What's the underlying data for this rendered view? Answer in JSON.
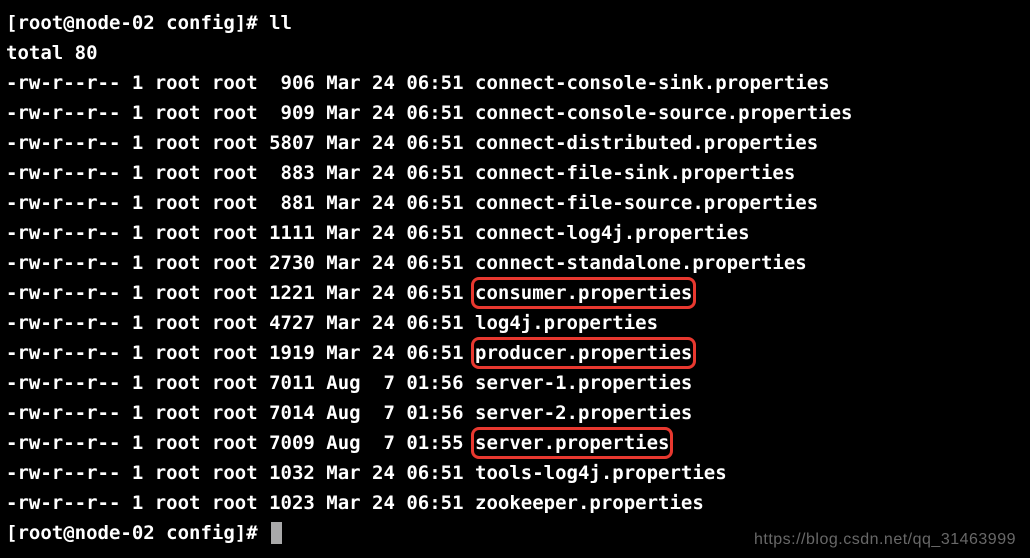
{
  "prompt1": "[root@node-02 config]# ",
  "command": "ll",
  "total_line": "total 80",
  "files": [
    {
      "perm": "-rw-r--r--",
      "links": "1",
      "owner": "root",
      "group": "root",
      "size": "  906",
      "date": "Mar 24 06:51",
      "name": "connect-console-sink.properties",
      "hl": false
    },
    {
      "perm": "-rw-r--r--",
      "links": "1",
      "owner": "root",
      "group": "root",
      "size": "  909",
      "date": "Mar 24 06:51",
      "name": "connect-console-source.properties",
      "hl": false
    },
    {
      "perm": "-rw-r--r--",
      "links": "1",
      "owner": "root",
      "group": "root",
      "size": " 5807",
      "date": "Mar 24 06:51",
      "name": "connect-distributed.properties",
      "hl": false
    },
    {
      "perm": "-rw-r--r--",
      "links": "1",
      "owner": "root",
      "group": "root",
      "size": "  883",
      "date": "Mar 24 06:51",
      "name": "connect-file-sink.properties",
      "hl": false
    },
    {
      "perm": "-rw-r--r--",
      "links": "1",
      "owner": "root",
      "group": "root",
      "size": "  881",
      "date": "Mar 24 06:51",
      "name": "connect-file-source.properties",
      "hl": false
    },
    {
      "perm": "-rw-r--r--",
      "links": "1",
      "owner": "root",
      "group": "root",
      "size": " 1111",
      "date": "Mar 24 06:51",
      "name": "connect-log4j.properties",
      "hl": false
    },
    {
      "perm": "-rw-r--r--",
      "links": "1",
      "owner": "root",
      "group": "root",
      "size": " 2730",
      "date": "Mar 24 06:51",
      "name": "connect-standalone.properties",
      "hl": false
    },
    {
      "perm": "-rw-r--r--",
      "links": "1",
      "owner": "root",
      "group": "root",
      "size": " 1221",
      "date": "Mar 24 06:51",
      "name": "consumer.properties",
      "hl": true
    },
    {
      "perm": "-rw-r--r--",
      "links": "1",
      "owner": "root",
      "group": "root",
      "size": " 4727",
      "date": "Mar 24 06:51",
      "name": "log4j.properties",
      "hl": false
    },
    {
      "perm": "-rw-r--r--",
      "links": "1",
      "owner": "root",
      "group": "root",
      "size": " 1919",
      "date": "Mar 24 06:51",
      "name": "producer.properties",
      "hl": true
    },
    {
      "perm": "-rw-r--r--",
      "links": "1",
      "owner": "root",
      "group": "root",
      "size": " 7011",
      "date": "Aug  7 01:56",
      "name": "server-1.properties",
      "hl": false
    },
    {
      "perm": "-rw-r--r--",
      "links": "1",
      "owner": "root",
      "group": "root",
      "size": " 7014",
      "date": "Aug  7 01:56",
      "name": "server-2.properties",
      "hl": false
    },
    {
      "perm": "-rw-r--r--",
      "links": "1",
      "owner": "root",
      "group": "root",
      "size": " 7009",
      "date": "Aug  7 01:55",
      "name": "server.properties",
      "hl": true
    },
    {
      "perm": "-rw-r--r--",
      "links": "1",
      "owner": "root",
      "group": "root",
      "size": " 1032",
      "date": "Mar 24 06:51",
      "name": "tools-log4j.properties",
      "hl": false
    },
    {
      "perm": "-rw-r--r--",
      "links": "1",
      "owner": "root",
      "group": "root",
      "size": " 1023",
      "date": "Mar 24 06:51",
      "name": "zookeeper.properties",
      "hl": false
    }
  ],
  "prompt2": "[root@node-02 config]# ",
  "watermark": "https://blog.csdn.net/qq_31463999"
}
